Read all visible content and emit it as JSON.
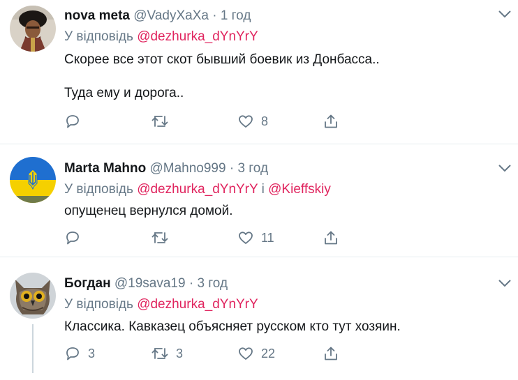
{
  "tweets": [
    {
      "name": "nova meta",
      "handle": "@VadyXaXa",
      "separator": "·",
      "time": "1 год",
      "reply_prefix": "У відповідь",
      "mentions": [
        "@dezhurka_dYnYrY"
      ],
      "lines": [
        "Скорее все этот скот бывший боевик из Донбасса..",
        "Туда ему и дорога.."
      ],
      "reply_count": "",
      "retweet_count": "",
      "like_count": "8"
    },
    {
      "name": "Marta Mahno",
      "handle": "@Mahno999",
      "separator": "·",
      "time": "3 год",
      "reply_prefix": "У відповідь",
      "mentions": [
        "@dezhurka_dYnYrY",
        "@Kieffskiy"
      ],
      "conjunction": "і",
      "lines": [
        "опущенец вернулся домой."
      ],
      "reply_count": "",
      "retweet_count": "",
      "like_count": "11"
    },
    {
      "name": "Богдан",
      "handle": "@19sava19",
      "separator": "·",
      "time": "3 год",
      "reply_prefix": "У відповідь",
      "mentions": [
        "@dezhurka_dYnYrY"
      ],
      "lines": [
        "Классика. Кавказец объясняет русском кто тут хозяин."
      ],
      "reply_count": "3",
      "retweet_count": "3",
      "like_count": "22"
    }
  ],
  "colors": {
    "mention": "#e0245e",
    "secondary_text": "#657786",
    "primary_text": "#14171a",
    "divider": "#e6ecf0"
  },
  "icons": [
    "reply-icon",
    "retweet-icon",
    "like-icon",
    "share-icon",
    "chevron-down-icon"
  ]
}
